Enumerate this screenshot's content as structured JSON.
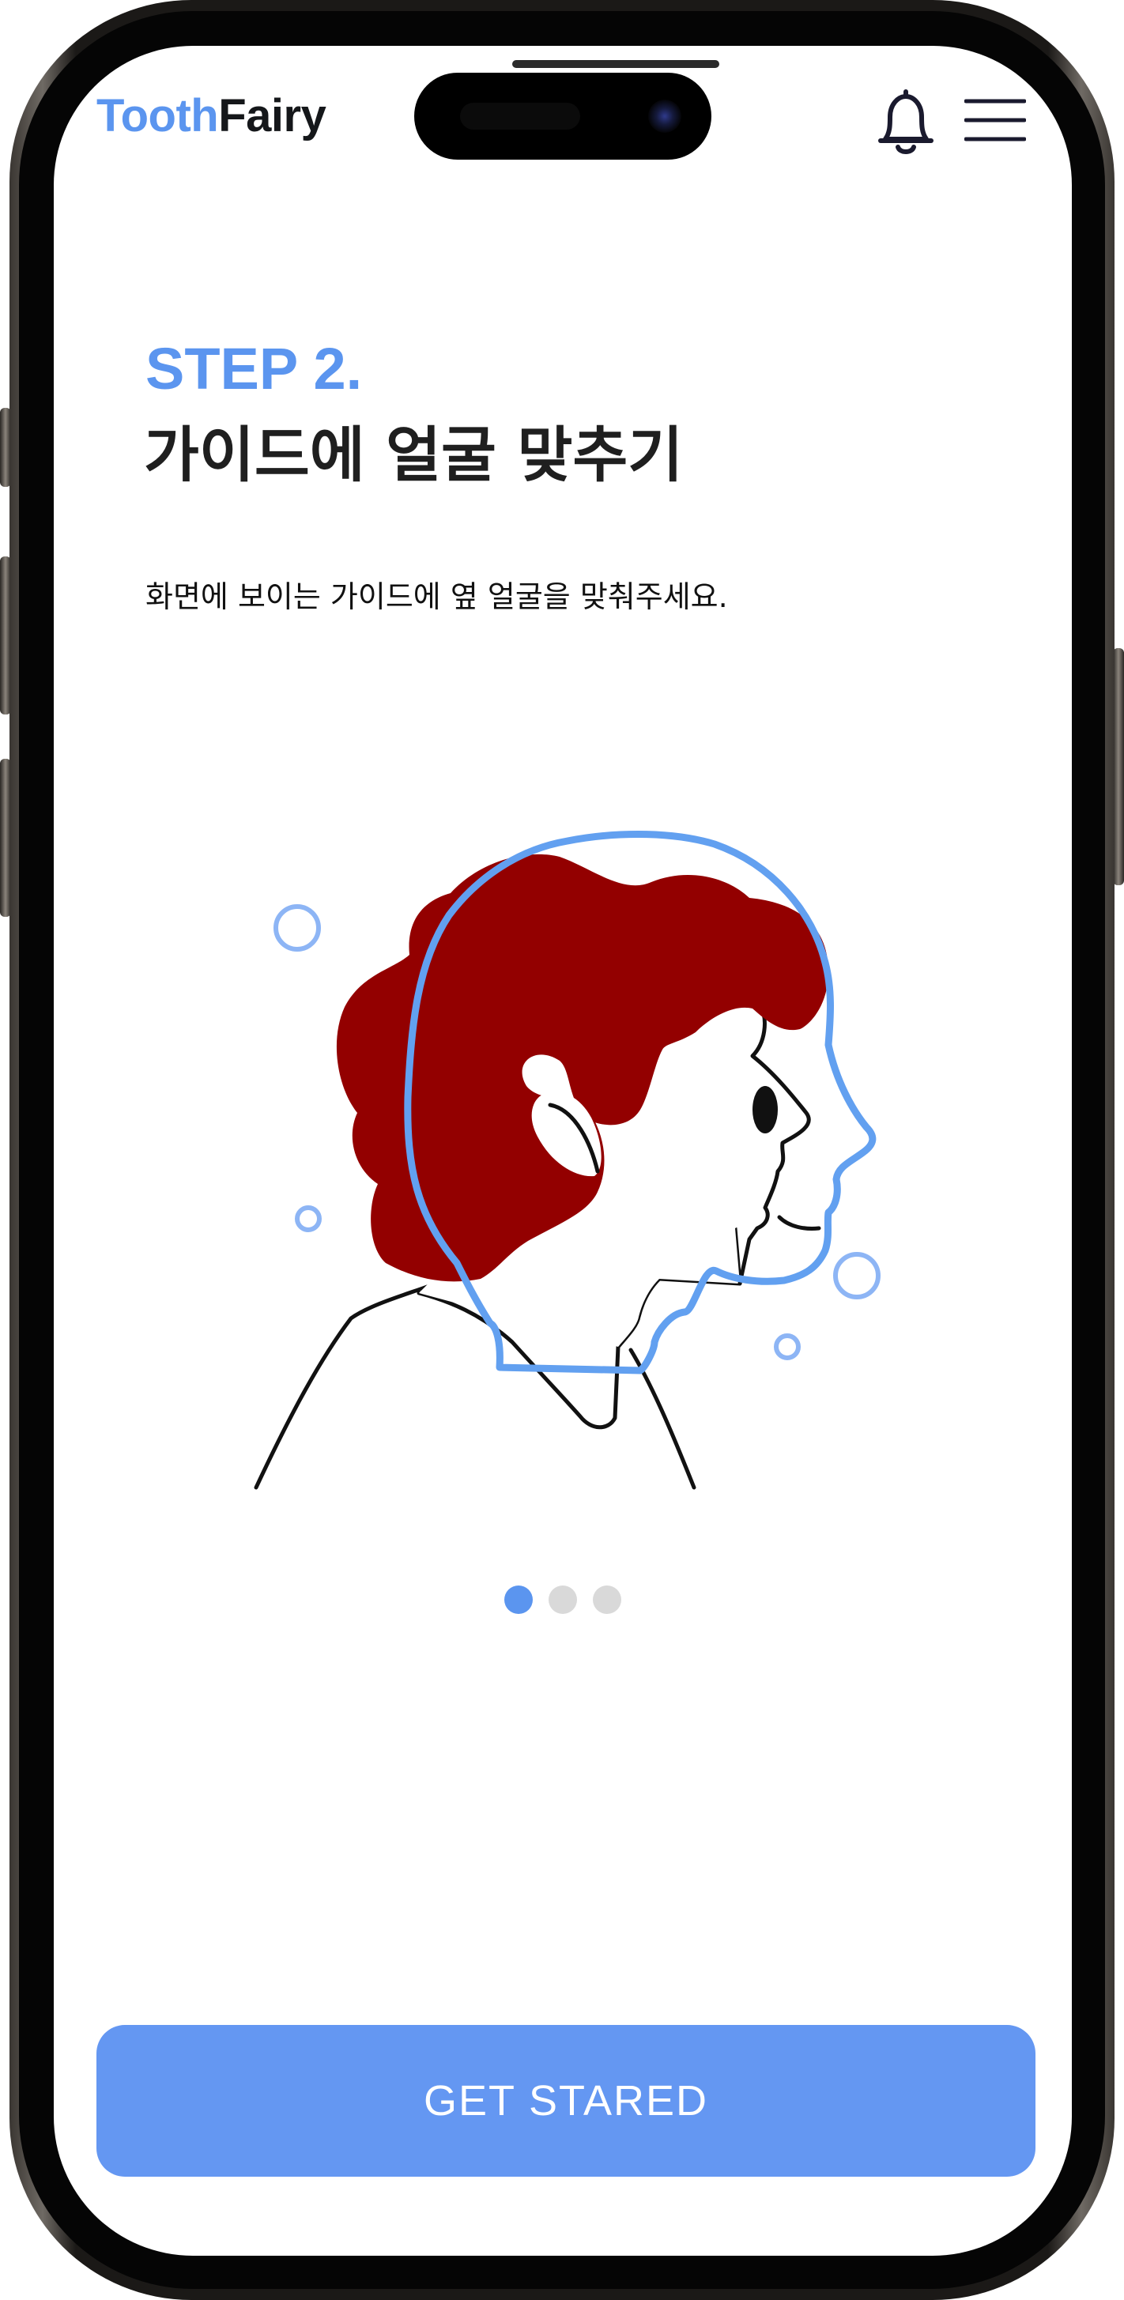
{
  "app": {
    "logo_part1": "Tooth",
    "logo_part2": "Fairy"
  },
  "header": {
    "notification_icon": "bell-icon",
    "menu_icon": "hamburger-menu-icon"
  },
  "onboarding": {
    "step_label": "STEP 2.",
    "title": "가이드에 얼굴 맞추기",
    "description": "화면에 보이는 가이드에 옆 얼굴을 맞춰주세요.",
    "pagination": {
      "total": 3,
      "active_index": 0
    },
    "cta_label": "GET STARED"
  },
  "colors": {
    "accent": "#5b95ef",
    "button": "#6497f2",
    "hair": "#930000",
    "guide_outline": "#62a0f0",
    "text_primary": "#1f1f1f",
    "dot_inactive": "#d9d9d9"
  }
}
